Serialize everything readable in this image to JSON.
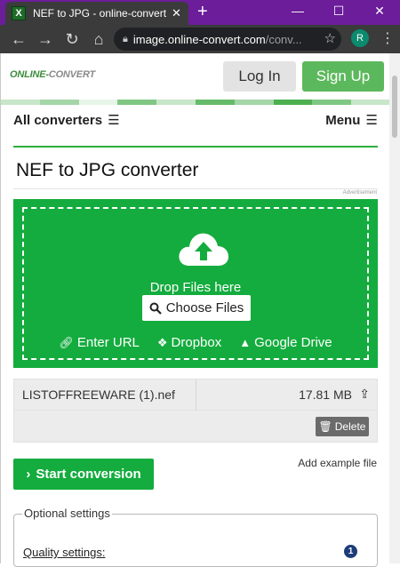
{
  "browser": {
    "tab_title": "NEF to JPG - online-convert.co",
    "tab_favicon_letter": "X",
    "tab_close": "✕",
    "new_tab": "+",
    "url_host": "image.online-convert.com",
    "url_path": "/conv...",
    "profile_initial": "R"
  },
  "header": {
    "logo_left": "ONLINE-",
    "logo_mid": "CONVERT",
    "login_label": "Log In",
    "signup_label": "Sign Up"
  },
  "nav": {
    "all_converters": "All converters",
    "menu": "Menu"
  },
  "page": {
    "title": "NEF to JPG converter",
    "advertisement": "Advertisement"
  },
  "dropzone": {
    "drop_text": "Drop Files here",
    "choose_label": "Choose Files",
    "enter_url": "Enter URL",
    "dropbox": "Dropbox",
    "google_drive": "Google Drive"
  },
  "file": {
    "name": "LISTOFFREEWARE (1).nef",
    "size": "17.81 MB",
    "delete_label": "Delete"
  },
  "actions": {
    "start_label": "Start conversion",
    "add_example": "Add example file"
  },
  "settings": {
    "legend": "Optional settings",
    "quality_label": "Quality settings:",
    "info_number": "1"
  },
  "colors": {
    "brand_green": "#14ac3e",
    "signup_green": "#5cb85c",
    "tab_purple": "#6b1d9a"
  }
}
